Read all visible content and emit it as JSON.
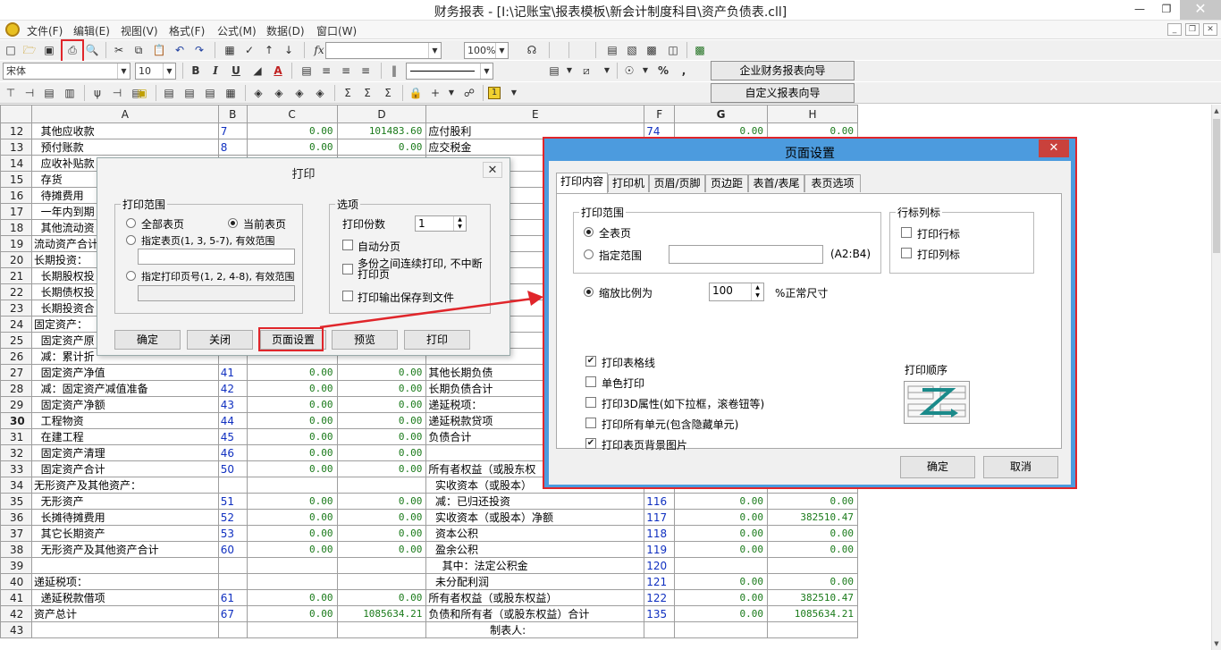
{
  "window": {
    "title": "财务报表 - [I:\\记账宝\\报表模板\\新会计制度科目\\资产负债表.cll]"
  },
  "menu": [
    "文件(F)",
    "编辑(E)",
    "视图(V)",
    "格式(F)",
    "公式(M)",
    "数据(D)",
    "窗口(W)"
  ],
  "toolbar": {
    "zoom": "100%",
    "font_name": "宋体",
    "font_size": "10",
    "fx": "fx",
    "bold": "B",
    "italic": "I",
    "underline": "U",
    "percent": "%",
    "comma": ",",
    "wizard1": "企业财务报表向导",
    "wizard2": "自定义报表向导"
  },
  "sheet": {
    "columns": [
      "A",
      "B",
      "C",
      "D",
      "E",
      "F",
      "G",
      "H"
    ],
    "rows": [
      {
        "n": "12",
        "a": "  其他应收款",
        "b": "7",
        "c": "0.00",
        "d": "101483.60",
        "e": "应付股利",
        "f": "74",
        "g": "0.00",
        "h": "0.00"
      },
      {
        "n": "13",
        "a": "  预付账款",
        "b": "8",
        "c": "0.00",
        "d": "0.00",
        "e": "应交税金",
        "f": "",
        "g": "",
        "h": ""
      },
      {
        "n": "14",
        "a": "  应收补贴款",
        "b": "",
        "c": "",
        "d": "",
        "e": "",
        "f": "",
        "g": "",
        "h": ""
      },
      {
        "n": "15",
        "a": "  存货",
        "b": "",
        "c": "",
        "d": "",
        "e": "",
        "f": "",
        "g": "",
        "h": ""
      },
      {
        "n": "16",
        "a": "  待摊费用",
        "b": "",
        "c": "",
        "d": "",
        "e": "",
        "f": "",
        "g": "",
        "h": ""
      },
      {
        "n": "17",
        "a": "  一年内到期",
        "b": "",
        "c": "",
        "d": "",
        "e": "",
        "f": "",
        "g": "",
        "h": ""
      },
      {
        "n": "18",
        "a": "  其他流动资",
        "b": "",
        "c": "",
        "d": "",
        "e": "",
        "f": "",
        "g": "",
        "h": ""
      },
      {
        "n": "19",
        "a": "流动资产合计",
        "b": "",
        "c": "",
        "d": "",
        "e": "",
        "f": "",
        "g": "",
        "h": ""
      },
      {
        "n": "20",
        "a": "长期投资：",
        "b": "",
        "c": "",
        "d": "",
        "e": "",
        "f": "",
        "g": "",
        "h": ""
      },
      {
        "n": "21",
        "a": "  长期股权投",
        "b": "",
        "c": "",
        "d": "",
        "e": "",
        "f": "",
        "g": "",
        "h": ""
      },
      {
        "n": "22",
        "a": "  长期债权投",
        "b": "",
        "c": "",
        "d": "",
        "e": "",
        "f": "",
        "g": "",
        "h": ""
      },
      {
        "n": "23",
        "a": "  长期投资合",
        "b": "",
        "c": "",
        "d": "",
        "e": "",
        "f": "",
        "g": "",
        "h": ""
      },
      {
        "n": "24",
        "a": "固定资产：",
        "b": "",
        "c": "",
        "d": "",
        "e": "",
        "f": "",
        "g": "",
        "h": ""
      },
      {
        "n": "25",
        "a": "  固定资产原",
        "b": "",
        "c": "",
        "d": "",
        "e": "",
        "f": "",
        "g": "",
        "h": ""
      },
      {
        "n": "26",
        "a": "  减：累计折",
        "b": "",
        "c": "",
        "d": "",
        "e": "",
        "f": "",
        "g": "",
        "h": ""
      },
      {
        "n": "27",
        "a": "  固定资产净值",
        "b": "41",
        "c": "0.00",
        "d": "0.00",
        "e": "其他长期负债",
        "f": "",
        "g": "",
        "h": ""
      },
      {
        "n": "28",
        "a": "  减：固定资产减值准备",
        "b": "42",
        "c": "0.00",
        "d": "0.00",
        "e": "长期负债合计",
        "f": "",
        "g": "",
        "h": ""
      },
      {
        "n": "29",
        "a": "  固定资产净额",
        "b": "43",
        "c": "0.00",
        "d": "0.00",
        "e": "递延税项：",
        "f": "",
        "g": "",
        "h": ""
      },
      {
        "n": "30",
        "a": "  工程物资",
        "b": "44",
        "c": "0.00",
        "d": "0.00",
        "e": "递延税款贷项",
        "f": "",
        "g": "",
        "h": ""
      },
      {
        "n": "31",
        "a": "  在建工程",
        "b": "45",
        "c": "0.00",
        "d": "0.00",
        "e": "负债合计",
        "f": "",
        "g": "",
        "h": ""
      },
      {
        "n": "32",
        "a": "  固定资产清理",
        "b": "46",
        "c": "0.00",
        "d": "0.00",
        "e": "",
        "f": "",
        "g": "",
        "h": ""
      },
      {
        "n": "33",
        "a": "  固定资产合计",
        "b": "50",
        "c": "0.00",
        "d": "0.00",
        "e": "所有者权益（或股东权",
        "f": "",
        "g": "",
        "h": ""
      },
      {
        "n": "34",
        "a": "无形资产及其他资产：",
        "b": "",
        "c": "",
        "d": "",
        "e": "  实收资本（或股本）",
        "f": "",
        "g": "",
        "h": ""
      },
      {
        "n": "35",
        "a": "  无形资产",
        "b": "51",
        "c": "0.00",
        "d": "0.00",
        "e": "  减：已归还投资",
        "f": "116",
        "g": "0.00",
        "h": "0.00"
      },
      {
        "n": "36",
        "a": "  长摊待摊费用",
        "b": "52",
        "c": "0.00",
        "d": "0.00",
        "e": "  实收资本（或股本）净额",
        "f": "117",
        "g": "0.00",
        "h": "382510.47"
      },
      {
        "n": "37",
        "a": "  其它长期资产",
        "b": "53",
        "c": "0.00",
        "d": "0.00",
        "e": "  资本公积",
        "f": "118",
        "g": "0.00",
        "h": "0.00"
      },
      {
        "n": "38",
        "a": "  无形资产及其他资产合计",
        "b": "60",
        "c": "0.00",
        "d": "0.00",
        "e": "  盈余公积",
        "f": "119",
        "g": "0.00",
        "h": "0.00"
      },
      {
        "n": "39",
        "a": "",
        "b": "",
        "c": "",
        "d": "",
        "e": "    其中：法定公积金",
        "f": "120",
        "g": "",
        "h": ""
      },
      {
        "n": "40",
        "a": "递延税项：",
        "b": "",
        "c": "",
        "d": "",
        "e": "  未分配利润",
        "f": "121",
        "g": "0.00",
        "h": "0.00"
      },
      {
        "n": "41",
        "a": "  递延税款借项",
        "b": "61",
        "c": "0.00",
        "d": "0.00",
        "e": "所有者权益（或股东权益）",
        "f": "122",
        "g": "0.00",
        "h": "382510.47"
      },
      {
        "n": "42",
        "a": "资产总计",
        "b": "67",
        "c": "0.00",
        "d": "1085634.21",
        "e": "负债和所有者（或股东权益）合计",
        "f": "135",
        "g": "0.00",
        "h": "1085634.21"
      },
      {
        "n": "43",
        "a": "",
        "b": "",
        "c": "",
        "d": "",
        "e": "                  制表人:",
        "f": "",
        "g": "",
        "h": ""
      }
    ]
  },
  "print_dialog": {
    "title": "打印",
    "range_group": "打印范围",
    "all_pages": "全部表页",
    "current_page": "当前表页",
    "specify_pages": "指定表页(1, 3, 5-7), 有效范围",
    "specify_print_pages": "指定打印页号(1, 2, 4-8), 有效范围",
    "options_group": "选项",
    "copies_label": "打印份数",
    "copies_value": "1",
    "auto_paging": "自动分页",
    "continuous": "多份之间连续打印, 不中断打印页",
    "save_to_file": "打印输出保存到文件",
    "buttons": [
      "确定",
      "关闭",
      "页面设置",
      "预览",
      "打印"
    ]
  },
  "page_setup": {
    "title": "页面设置",
    "tabs": [
      "打印内容",
      "打印机",
      "页眉/页脚",
      "页边距",
      "表首/表尾",
      "表页选项"
    ],
    "range_group": "打印范围",
    "all_pages": "全表页",
    "specify_range": "指定范围",
    "range_hint": "(A2:B4)",
    "header_group": "行标列标",
    "print_row_header": "打印行标",
    "print_col_header": "打印列标",
    "scale_label": "缩放比例为",
    "scale_value": "100",
    "scale_unit": "%正常尺寸",
    "options": [
      {
        "label": "打印表格线",
        "checked": true
      },
      {
        "label": "单色打印",
        "checked": false
      },
      {
        "label": "打印3D属性(如下拉框，滚卷钮等)",
        "checked": false
      },
      {
        "label": "打印所有单元(包含隐藏单元)",
        "checked": false
      },
      {
        "label": "打印表页背景图片",
        "checked": true
      }
    ],
    "order_label": "打印顺序",
    "ok": "确定",
    "cancel": "取消"
  }
}
